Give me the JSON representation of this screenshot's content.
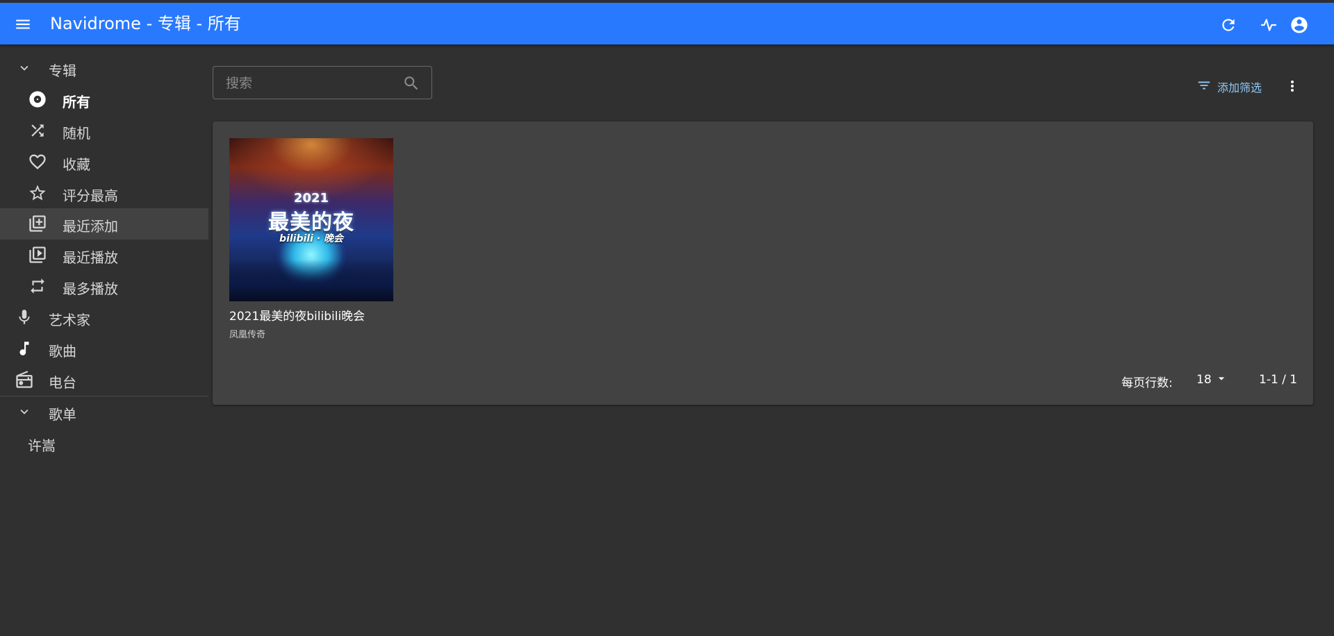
{
  "appbar": {
    "title": "Navidrome - 专辑 - 所有",
    "icons": [
      "menu-icon",
      "refresh-icon",
      "activity-icon",
      "account-icon"
    ],
    "color": "#2979ff"
  },
  "sidebar": {
    "albums_section": {
      "label": "专辑",
      "icon": "chevron-down-icon"
    },
    "album_items": [
      {
        "label": "所有",
        "icon": "album-icon",
        "active": false,
        "bold": true
      },
      {
        "label": "随机",
        "icon": "shuffle-icon",
        "active": false
      },
      {
        "label": "收藏",
        "icon": "heart-icon",
        "active": false
      },
      {
        "label": "评分最高",
        "icon": "star-icon",
        "active": false
      },
      {
        "label": "最近添加",
        "icon": "library-add-icon",
        "active": true
      },
      {
        "label": "最近播放",
        "icon": "video-library-icon",
        "active": false
      },
      {
        "label": "最多播放",
        "icon": "repeat-icon",
        "active": false
      }
    ],
    "top_items": [
      {
        "label": "艺术家",
        "icon": "microphone-icon"
      },
      {
        "label": "歌曲",
        "icon": "music-note-icon"
      },
      {
        "label": "电台",
        "icon": "radio-icon"
      }
    ],
    "playlists_section": {
      "label": "歌单",
      "icon": "chevron-down-icon"
    },
    "playlists": [
      {
        "label": "许嵩"
      }
    ]
  },
  "toolbar": {
    "search_placeholder": "搜索",
    "search_value": "",
    "add_filter_label": "添加筛选",
    "accent": "#90caf9"
  },
  "albums": [
    {
      "title": "2021最美的夜bilibili晚会",
      "artist": "凤凰传奇",
      "cover_text": {
        "year": "2021",
        "headline": "最美的夜",
        "sub": "bilibili · 晚会"
      }
    }
  ],
  "pagination": {
    "rows_per_page_label": "每页行数:",
    "rows_per_page": "18",
    "range": "1-1 / 1"
  }
}
